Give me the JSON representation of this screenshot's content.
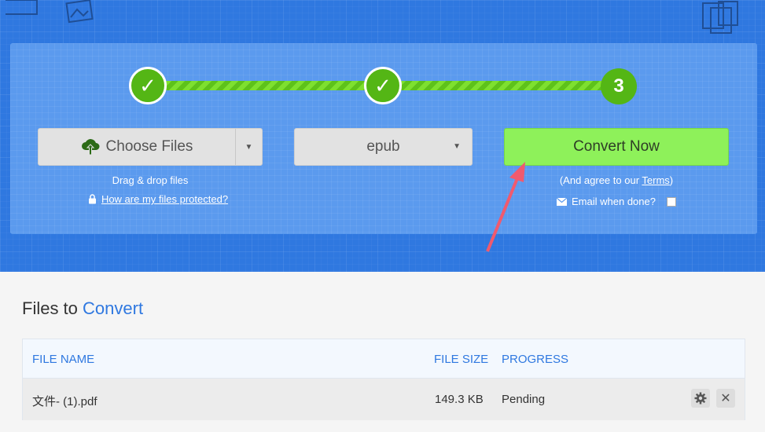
{
  "steps": {
    "step1_mark": "✓",
    "step2_mark": "✓",
    "step3_label": "3"
  },
  "upload": {
    "choose_label": "Choose Files",
    "drag_hint": "Drag & drop files",
    "protect_link": "How are my files protected?"
  },
  "format": {
    "selected": "epub"
  },
  "convert": {
    "button_label": "Convert Now",
    "agree_prefix": "(And agree to our ",
    "terms_link": "Terms",
    "agree_suffix": ")",
    "email_label": "Email when done?"
  },
  "files": {
    "title_prefix": "Files to",
    "title_accent": "Convert",
    "columns": {
      "name": "FILE NAME",
      "size": "FILE SIZE",
      "progress": "PROGRESS"
    },
    "rows": [
      {
        "name": "文件- (1).pdf",
        "size": "149.3 KB",
        "progress": "Pending"
      }
    ]
  },
  "colors": {
    "hero_blue": "#2f78e0",
    "step_green": "#54b615",
    "convert_green": "#8ef15a",
    "accent_blue": "#2f78e0",
    "annotation_red": "#f05a6e"
  }
}
